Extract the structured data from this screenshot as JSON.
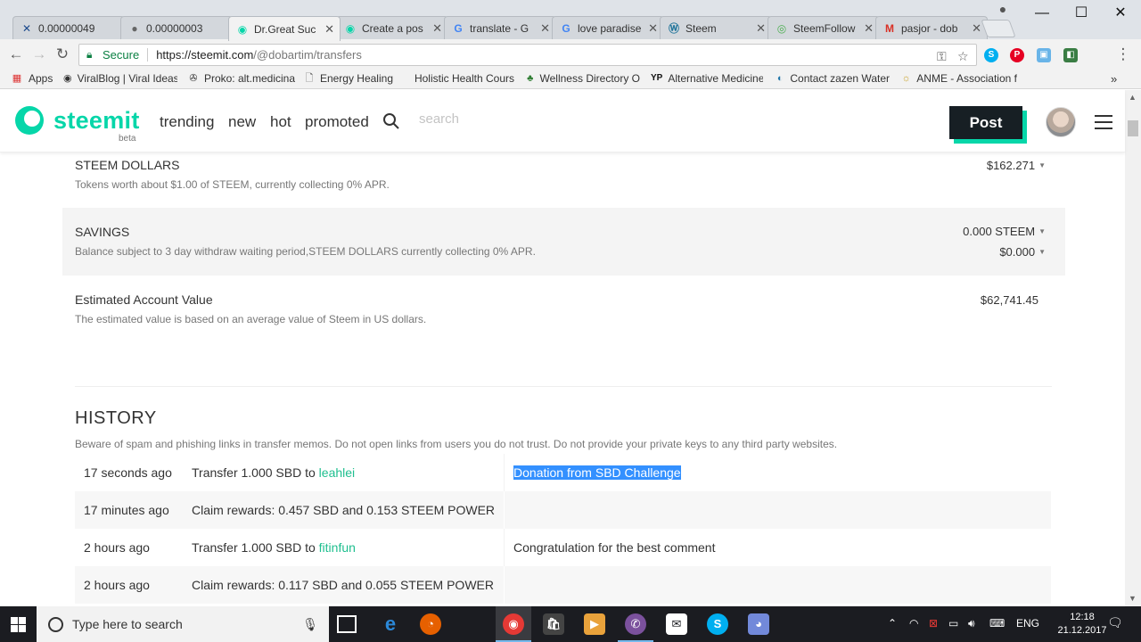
{
  "browser": {
    "tabs": [
      {
        "label": "0.00000049",
        "icon": "x-icon",
        "color": "#1c4a8c"
      },
      {
        "label": "0.00000003",
        "icon": "coin-icon",
        "color": "#666666"
      },
      {
        "label": "Dr.Great Suc",
        "icon": "steemit-icon",
        "color": "#06d6a9"
      },
      {
        "label": "Create a pos",
        "icon": "steemit-icon",
        "color": "#06d6a9"
      },
      {
        "label": "translate - G",
        "icon": "google-icon",
        "color": "#4285f4"
      },
      {
        "label": "love paradise",
        "icon": "google-icon",
        "color": "#4285f4"
      },
      {
        "label": "Steem",
        "icon": "wordpress-icon",
        "color": "#21759b"
      },
      {
        "label": "SteemFollow",
        "icon": "steemfollow-icon",
        "color": "#4caf50"
      },
      {
        "label": "pasjor - dob",
        "icon": "gmail-icon",
        "color": "#d93025"
      }
    ],
    "address": {
      "secure_label": "Secure",
      "host": "https://steemit.com",
      "path": "/@dobartim/transfers"
    },
    "bookmarks": [
      {
        "label": "Apps",
        "icon": "apps-grid-icon"
      },
      {
        "label": "ViralBlog | Viral Ideas",
        "icon": "viralblog-icon"
      },
      {
        "label": "Proko: alt.medicina",
        "icon": "proko-icon"
      },
      {
        "label": "Energy Healing",
        "icon": "page-icon"
      },
      {
        "label": "Holistic Health Cours",
        "icon": "blank-icon"
      },
      {
        "label": "Wellness Directory O",
        "icon": "palm-icon"
      },
      {
        "label": "Alternative Medicine",
        "icon": "yp-icon"
      },
      {
        "label": "Contact zazen Water",
        "icon": "zazen-icon"
      },
      {
        "label": "ANME - Association f",
        "icon": "sun-icon"
      }
    ]
  },
  "steemit": {
    "logo": "steemit",
    "beta": "beta",
    "nav": [
      "trending",
      "new",
      "hot",
      "promoted"
    ],
    "search_placeholder": "search",
    "post_label": "Post",
    "accent": "#06d6a9"
  },
  "wallet": {
    "steem_dollars": {
      "title": "STEEM DOLLARS",
      "desc": "Tokens worth about $1.00 of STEEM, currently collecting 0% APR.",
      "value": "$162.271"
    },
    "savings": {
      "title": "SAVINGS",
      "desc": "Balance subject to 3 day withdraw waiting period,STEEM DOLLARS currently collecting 0% APR.",
      "value1": "0.000 STEEM",
      "value2": "$0.000"
    },
    "estimated": {
      "title": "Estimated Account Value",
      "desc": "The estimated value is based on an average value of Steem in US dollars.",
      "value": "$62,741.45"
    }
  },
  "history": {
    "title": "HISTORY",
    "warning": "Beware of spam and phishing links in transfer memos. Do not open links from users you do not trust. Do not provide your private keys to any third party websites.",
    "rows": [
      {
        "time": "17 seconds ago",
        "text": "Transfer 1.000 SBD to ",
        "user": "leahlei",
        "memo": "Donation from SBD Challenge"
      },
      {
        "time": "17 minutes ago",
        "text": "Claim rewards: 0.457 SBD and 0.153 STEEM POWER",
        "user": "",
        "memo": ""
      },
      {
        "time": "2 hours ago",
        "text": "Transfer 1.000 SBD to ",
        "user": "fitinfun",
        "memo": "Congratulation for the best comment"
      },
      {
        "time": "2 hours ago",
        "text": "Claim rewards: 0.117 SBD and 0.055 STEEM POWER",
        "user": "",
        "memo": ""
      }
    ]
  },
  "taskbar": {
    "search_placeholder": "Type here to search",
    "lang": "ENG",
    "time": "12:18",
    "date": "21.12.2017"
  }
}
